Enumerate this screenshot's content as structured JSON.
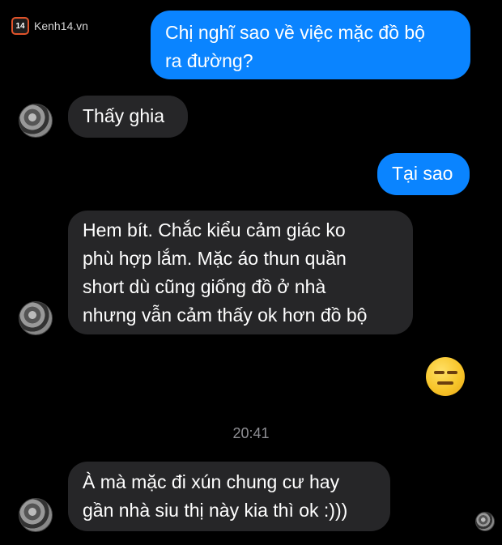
{
  "watermark": {
    "logo_text": "14",
    "site": "Kenh14.vn"
  },
  "messages": [
    {
      "lines": [
        "Chị nghĩ sao về việc mặc đồ bộ",
        "ra đường?"
      ]
    },
    {
      "lines": [
        "Thấy ghia"
      ]
    },
    {
      "lines": [
        "Tại sao"
      ]
    },
    {
      "lines": [
        "Hem bít. Chắc kiểu cảm giác ko",
        "phù hợp lắm. Mặc áo thun quần",
        "short dù cũng giống đồ ở nhà",
        "nhưng vẫn cảm thấy ok hơn đồ bộ"
      ]
    },
    {
      "emoji": "expressionless-face-emoji"
    },
    {
      "lines": [
        "À mà mặc đi xún chung cư hay",
        "gần nhà siu thị này kia thì ok :)))"
      ]
    }
  ],
  "timestamp": "20:41",
  "colors": {
    "outgoing": "#0a84ff",
    "incoming": "#262628",
    "background": "#000000"
  }
}
